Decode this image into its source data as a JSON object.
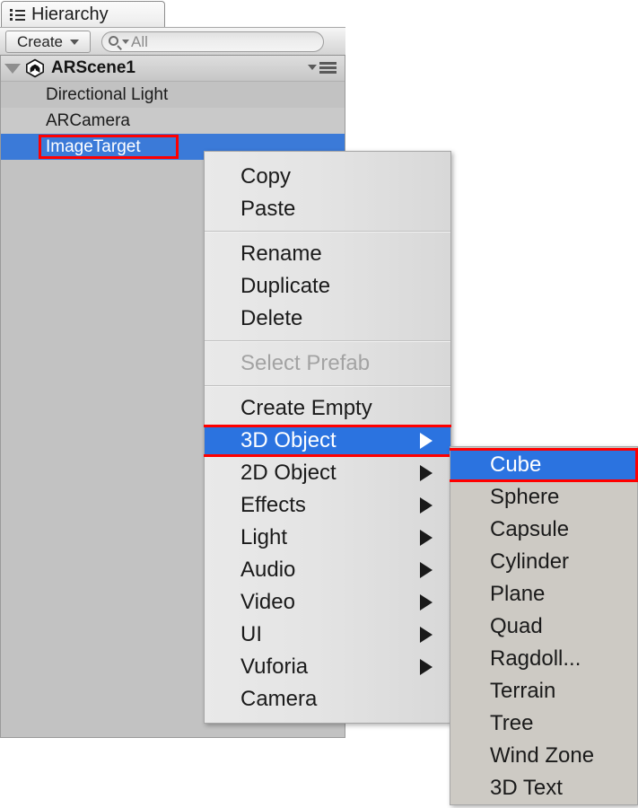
{
  "panel": {
    "tab_label": "Hierarchy",
    "tab_icon": "list-icon",
    "toolbar": {
      "create_label": "Create",
      "create_caret_icon": "chevron-down-icon",
      "search_placeholder": "All",
      "search_value": "All",
      "search_icon": "search-icon",
      "search_dropdown_icon": "chevron-down-icon"
    },
    "scene": {
      "name": "ARScene1",
      "disclosure_icon": "triangle-down-icon",
      "unity_icon": "unity-logo-icon",
      "options_icon": "hamburger-menu-icon"
    },
    "items": [
      {
        "label": "Directional Light",
        "selected": false
      },
      {
        "label": "ARCamera",
        "selected": false
      },
      {
        "label": "ImageTarget",
        "selected": true
      }
    ]
  },
  "context_menu": {
    "groups": [
      {
        "items": [
          {
            "label": "Copy",
            "submenu": false,
            "disabled": false,
            "highlighted": false
          },
          {
            "label": "Paste",
            "submenu": false,
            "disabled": false,
            "highlighted": false
          }
        ]
      },
      {
        "items": [
          {
            "label": "Rename",
            "submenu": false,
            "disabled": false,
            "highlighted": false
          },
          {
            "label": "Duplicate",
            "submenu": false,
            "disabled": false,
            "highlighted": false
          },
          {
            "label": "Delete",
            "submenu": false,
            "disabled": false,
            "highlighted": false
          }
        ]
      },
      {
        "items": [
          {
            "label": "Select Prefab",
            "submenu": false,
            "disabled": true,
            "highlighted": false
          }
        ]
      },
      {
        "items": [
          {
            "label": "Create Empty",
            "submenu": false,
            "disabled": false,
            "highlighted": false
          },
          {
            "label": "3D Object",
            "submenu": true,
            "disabled": false,
            "highlighted": true
          },
          {
            "label": "2D Object",
            "submenu": true,
            "disabled": false,
            "highlighted": false
          },
          {
            "label": "Effects",
            "submenu": true,
            "disabled": false,
            "highlighted": false
          },
          {
            "label": "Light",
            "submenu": true,
            "disabled": false,
            "highlighted": false
          },
          {
            "label": "Audio",
            "submenu": true,
            "disabled": false,
            "highlighted": false
          },
          {
            "label": "Video",
            "submenu": true,
            "disabled": false,
            "highlighted": false
          },
          {
            "label": "UI",
            "submenu": true,
            "disabled": false,
            "highlighted": false
          },
          {
            "label": "Vuforia",
            "submenu": true,
            "disabled": false,
            "highlighted": false
          },
          {
            "label": "Camera",
            "submenu": false,
            "disabled": false,
            "highlighted": false
          }
        ]
      }
    ]
  },
  "submenu": {
    "parent": "3D Object",
    "items": [
      {
        "label": "Cube",
        "highlighted": true
      },
      {
        "label": "Sphere",
        "highlighted": false
      },
      {
        "label": "Capsule",
        "highlighted": false
      },
      {
        "label": "Cylinder",
        "highlighted": false
      },
      {
        "label": "Plane",
        "highlighted": false
      },
      {
        "label": "Quad",
        "highlighted": false
      },
      {
        "label": "Ragdoll...",
        "highlighted": false
      },
      {
        "label": "Terrain",
        "highlighted": false
      },
      {
        "label": "Tree",
        "highlighted": false
      },
      {
        "label": "Wind Zone",
        "highlighted": false
      },
      {
        "label": "3D Text",
        "highlighted": false
      }
    ]
  },
  "annotations": {
    "color": "#ff0000",
    "boxes": [
      "ImageTarget",
      "3D Object",
      "Cube"
    ]
  },
  "colors": {
    "selection_blue": "#3b7ad8",
    "menu_highlight_blue": "#2b73e0",
    "panel_background": "#c2c2c2",
    "menu_background": "#e4e4e4",
    "submenu_background": "#cdcac4",
    "annotation_red": "#ff0000"
  }
}
